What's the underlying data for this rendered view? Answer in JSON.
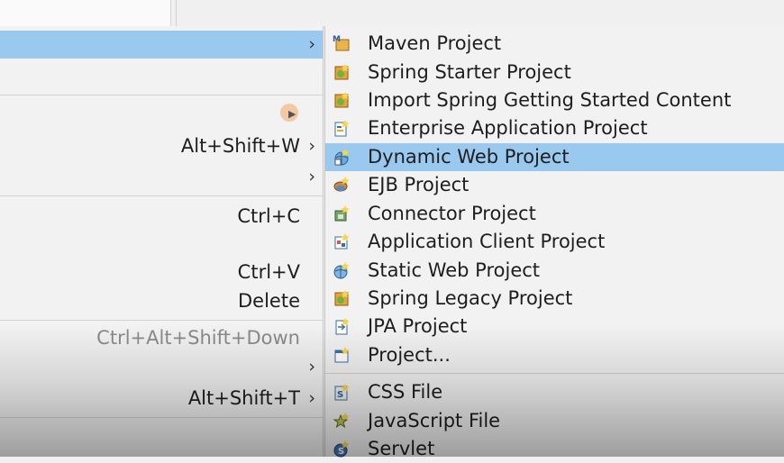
{
  "left_menu": {
    "items": [
      {
        "accelerator": "",
        "has_submenu": true,
        "highlighted": true
      },
      {
        "accelerator": "Alt+Shift+W",
        "has_submenu": true
      },
      {
        "accelerator": "",
        "has_submenu": true
      },
      {
        "accelerator": "Ctrl+C"
      },
      {
        "accelerator": "Ctrl+V"
      },
      {
        "accelerator": "Delete"
      },
      {
        "accelerator": "Ctrl+Alt+Shift+Down",
        "disabled": true
      },
      {
        "accelerator": "",
        "has_submenu": true
      },
      {
        "accelerator": "Alt+Shift+T",
        "has_submenu": true
      }
    ],
    "arrow_glyph": "›"
  },
  "submenu": {
    "items": [
      {
        "label": "Maven Project",
        "icon": "maven-project-icon"
      },
      {
        "label": "Spring Starter Project",
        "icon": "spring-starter-icon"
      },
      {
        "label": "Import Spring Getting Started Content",
        "icon": "spring-import-icon"
      },
      {
        "label": "Enterprise Application Project",
        "icon": "enterprise-app-icon"
      },
      {
        "label": "Dynamic Web Project",
        "icon": "dynamic-web-icon",
        "highlighted": true
      },
      {
        "label": "EJB Project",
        "icon": "ejb-project-icon"
      },
      {
        "label": "Connector Project",
        "icon": "connector-project-icon"
      },
      {
        "label": "Application Client Project",
        "icon": "app-client-icon"
      },
      {
        "label": "Static Web Project",
        "icon": "static-web-icon"
      },
      {
        "label": "Spring Legacy Project",
        "icon": "spring-legacy-icon"
      },
      {
        "label": "JPA Project",
        "icon": "jpa-project-icon"
      },
      {
        "label": "Project...",
        "icon": "generic-project-icon"
      },
      {
        "label": "CSS File",
        "icon": "css-file-icon"
      },
      {
        "label": "JavaScript File",
        "icon": "javascript-file-icon"
      },
      {
        "label": "Servlet",
        "icon": "servlet-icon"
      }
    ]
  },
  "colors": {
    "menu_bg": "#f2f2f2",
    "highlight": "#99c9ef",
    "disabled_text": "#8b8b8b",
    "spring_green": "#6db33f",
    "wizard_orange": "#e8a33b"
  }
}
